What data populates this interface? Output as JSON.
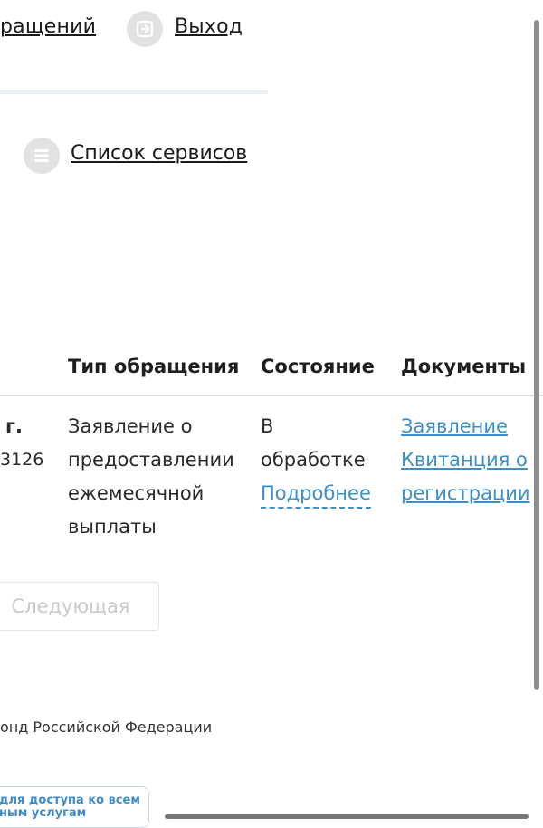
{
  "topnav": {
    "appeals_label": "ращений",
    "exit_label": "Выход",
    "exit_icon": "exit-arrow-icon"
  },
  "services": {
    "label": "Список сервисов",
    "icon": "list-icon"
  },
  "table": {
    "headers": [
      "Тип обращения",
      "Состояние",
      "Документы"
    ],
    "row": {
      "date_fragment": "г.",
      "number_fragment": "3126",
      "type_lines": [
        "Заявление о",
        "предоставлении",
        "ежемесячной",
        "выплаты"
      ],
      "status_lines": [
        "В",
        "обработке"
      ],
      "details_label": "Подробнее",
      "documents": [
        "Заявление",
        "Квитанция о",
        "регистрации"
      ]
    }
  },
  "pagination": {
    "next_label": "Следующая"
  },
  "footer": {
    "text": "онд Российской Федерации",
    "badge_lines": [
      "для доступа ко всем",
      "ным услугам"
    ]
  },
  "colors": {
    "link_blue": "#3d8fc9",
    "icon_bg": "#e2e2e2",
    "disabled_text": "#c9c9c9"
  }
}
